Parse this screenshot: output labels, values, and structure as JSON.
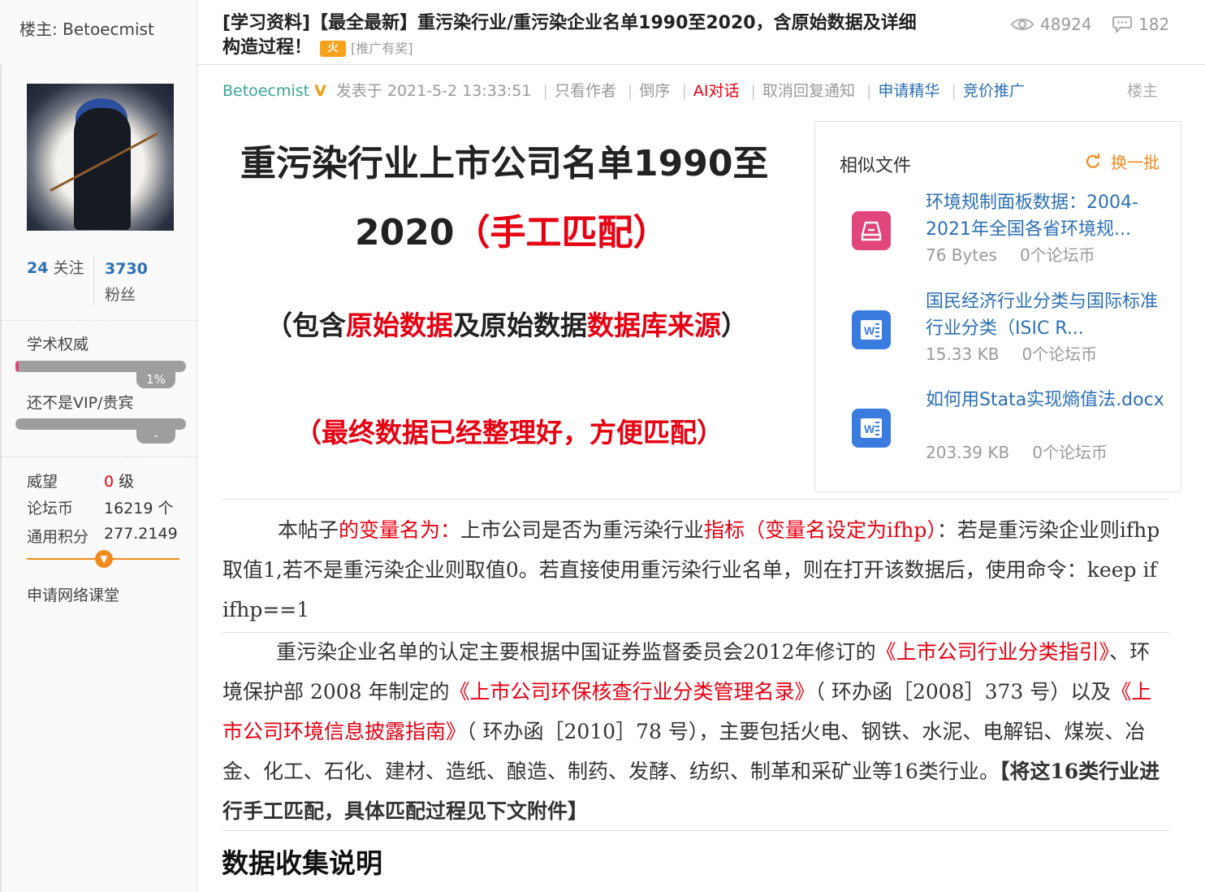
{
  "header": {
    "owner_label": "楼主: Betoecmist",
    "title_line1": "[学习资料]【最全最新】重污染行业/重污染企业名单1990至2020，含原始数据及详细",
    "title_line2": "构造过程！",
    "promo_badge": "火",
    "promo_text": "[推广有奖]",
    "views": "48924",
    "replies": "182"
  },
  "sidebar": {
    "follow_count": "24",
    "follow_label": "关注",
    "fans_count": "3730",
    "fans_label": "粉丝",
    "authority_label": "学术权威",
    "authority_pct": "1%",
    "authority_fraction": 0.01,
    "vip_label": "还不是VIP/贵宾",
    "vip_tag": "-",
    "prestige_label": "威望",
    "prestige_value": "0",
    "prestige_unit": "级",
    "coins_label": "论坛币",
    "coins_value": "16219 个",
    "points_label": "通用积分",
    "points_value": "277.2149",
    "apply_label": "申请网络课堂"
  },
  "meta": {
    "author": "Betoecmist",
    "posted": "发表于 2021-5-2 13:33:51",
    "only_author": "只看作者",
    "reverse": "倒序",
    "ai_chat": "AI对话",
    "cancel_notify": "取消回复通知",
    "apply_digest": "申请精华",
    "bid_promote": "竞价推广",
    "floor": "楼主"
  },
  "headline": {
    "line1": "重污染行业上市公司名单1990至",
    "line2_a": "2020",
    "line2_b": "（手工匹配）",
    "line3_a": "（包含",
    "line3_b": "原始数据",
    "line3_c": "及原始数据",
    "line3_d": "数据库来源",
    "line3_e": "）",
    "line4": "（最终数据已经整理好，方便匹配）"
  },
  "similar": {
    "title": "相似文件",
    "refresh": "换一批",
    "files": [
      {
        "name": "环境规制面板数据：2004-2021年全国各省环境规...",
        "size": "76 Bytes",
        "coins": "0个论坛币",
        "icon": "archive-icon",
        "color": "#e0457b"
      },
      {
        "name": "国民经济行业分类与国际标准行业分类（ISIC R...",
        "size": "15.33 KB",
        "coins": "0个论坛币",
        "icon": "word-doc-icon",
        "color": "#3a7be0"
      },
      {
        "name": "如何用Stata实现熵值法.docx",
        "size": "203.39 KB",
        "coins": "0个论坛币",
        "icon": "word-doc-icon",
        "color": "#3a7be0"
      }
    ]
  },
  "body": {
    "p1_a": "本帖子",
    "p1_b": "的变量名为：",
    "p1_c": "上市公司是否为重污染行业",
    "p1_d": "指标（变量名设定为ifhp）",
    "p1_e": "：若是重污染企业则ifhp取值1,若不是重污染企业则取值0。若直接使用重污染行业名单，则在打开该数据后，使用命令：keep if ifhp==1",
    "p2_a": "重污染企业名单的认定主要根据中国证券监督委员会2012年修订的",
    "p2_b": "《上市公司行业分类指引》",
    "p2_c": "、环境保护部 2008 年制定的",
    "p2_d": "《上市公司环保核查行业分类管理名录》",
    "p2_e": "（ 环办函［2008］373 号）以及",
    "p2_f": "《上市公司环境信息披露指南》",
    "p2_g": "（ 环办函［2010］78 号），主要包括火电、钢铁、水泥、电解铝、煤炭、冶金、化工、石化、建材、造纸、酿造、制药、发酵、纺织、制革和采矿业等16类行业。",
    "p2_h": "【将这16类行业进行手工匹配，具体匹配过程见下文附件】",
    "section_title": "数据收集说明"
  }
}
